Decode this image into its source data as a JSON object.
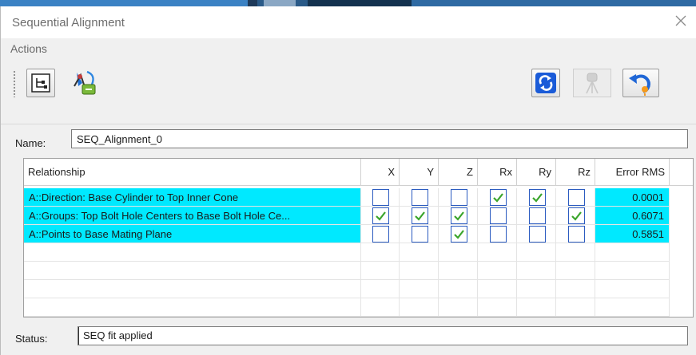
{
  "window": {
    "title": "Sequential Alignment"
  },
  "menu": {
    "actions": "Actions"
  },
  "toolbar": {
    "icons": [
      "tree-view-icon",
      "fit-settings-icon",
      "refresh-icon",
      "instrument-icon",
      "undo-icon"
    ]
  },
  "name": {
    "label": "Name:",
    "value": "SEQ_Alignment_0"
  },
  "table": {
    "headers": {
      "relationship": "Relationship",
      "x": "X",
      "y": "Y",
      "z": "Z",
      "rx": "Rx",
      "ry": "Ry",
      "rz": "Rz",
      "rms": "Error RMS"
    },
    "highlight_color": "#00e9ff",
    "rows": [
      {
        "relationship": "A::Direction: Base Cylinder to Top Inner Cone",
        "x": false,
        "y": false,
        "z": false,
        "rx": true,
        "ry": true,
        "rz": false,
        "rms": "0.0001"
      },
      {
        "relationship": "A::Groups: Top Bolt Hole Centers to Base Bolt Hole Ce...",
        "x": true,
        "y": true,
        "z": true,
        "rx": false,
        "ry": false,
        "rz": true,
        "rms": "0.6071"
      },
      {
        "relationship": "A::Points to Base Mating Plane",
        "x": false,
        "y": false,
        "z": true,
        "rx": false,
        "ry": false,
        "rz": false,
        "rms": "0.5851"
      }
    ]
  },
  "status": {
    "label": "Status:",
    "value": "SEQ fit applied"
  }
}
